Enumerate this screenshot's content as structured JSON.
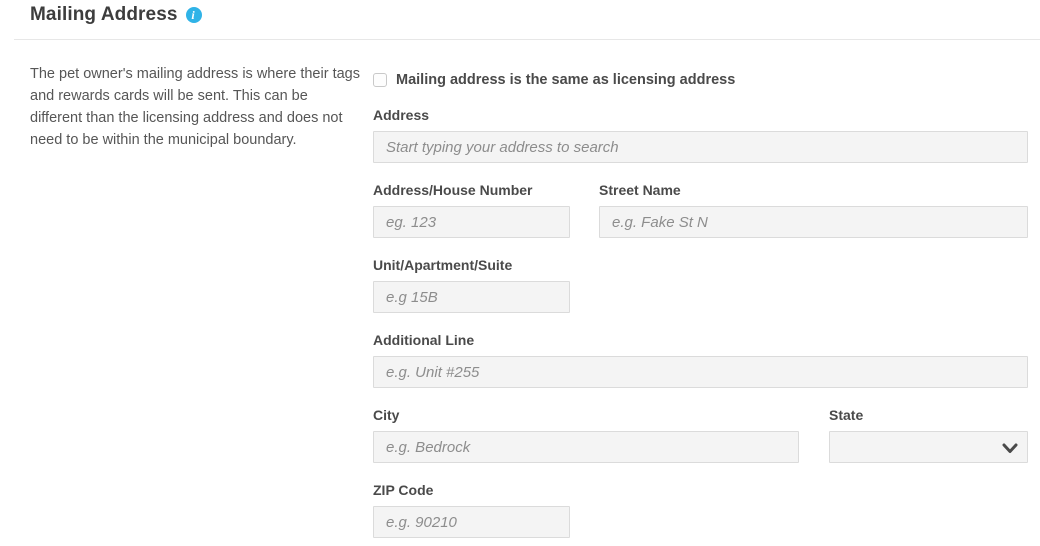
{
  "header": {
    "title": "Mailing Address",
    "info_icon": "i"
  },
  "description": "The pet owner's mailing address is where their tags and rewards cards will be sent. This can be different than the licensing address and does not need to be within the municipal boundary.",
  "form": {
    "same_address_checkbox": {
      "label": "Mailing address is the same as licensing address",
      "checked": false
    },
    "fields": {
      "address_search": {
        "label": "Address",
        "placeholder": "Start typing your address to search",
        "value": ""
      },
      "house_number": {
        "label": "Address/House Number",
        "placeholder": "eg. 123",
        "value": ""
      },
      "street_name": {
        "label": "Street Name",
        "placeholder": "e.g. Fake St N",
        "value": ""
      },
      "unit": {
        "label": "Unit/Apartment/Suite",
        "placeholder": "e.g 15B",
        "value": ""
      },
      "additional_line": {
        "label": "Additional Line",
        "placeholder": "e.g. Unit #255",
        "value": ""
      },
      "city": {
        "label": "City",
        "placeholder": "e.g. Bedrock",
        "value": ""
      },
      "state": {
        "label": "State",
        "selected_value": ""
      },
      "zip": {
        "label": "ZIP Code",
        "placeholder": "e.g. 90210",
        "value": ""
      }
    }
  },
  "colors": {
    "info_icon": "#30b3e7",
    "input_background": "#f4f4f4",
    "input_border": "#dbdbdb",
    "label_text": "#4a4a4a",
    "placeholder_text": "#8d8d8d"
  }
}
